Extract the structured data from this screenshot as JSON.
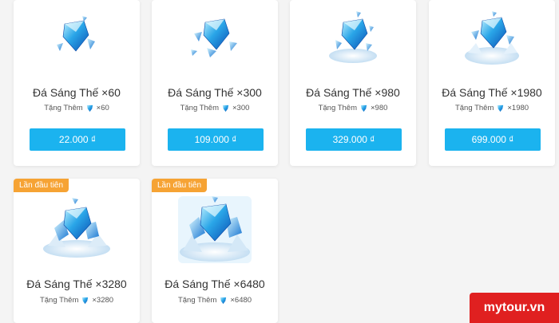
{
  "packages_row1": [
    {
      "name": "Đá Sáng Thế ×60",
      "bonus_label": "Tặng Thêm",
      "bonus_amount": "×60",
      "price": "22.000 ₫",
      "gem_icon": "crystal-gem-icon"
    },
    {
      "name": "Đá Sáng Thế ×300",
      "bonus_label": "Tặng Thêm",
      "bonus_amount": "×300",
      "price": "109.000 ₫",
      "gem_icon": "crystal-gem-icon"
    },
    {
      "name": "Đá Sáng Thế ×980",
      "bonus_label": "Tặng Thêm",
      "bonus_amount": "×980",
      "price": "329.000 ₫",
      "gem_icon": "crystal-gem-icon"
    },
    {
      "name": "Đá Sáng Thế ×1980",
      "bonus_label": "Tặng Thêm",
      "bonus_amount": "×1980",
      "price": "699.000 ₫",
      "gem_icon": "crystal-gem-icon"
    }
  ],
  "packages_row2": [
    {
      "badge": "Lần đầu tiên",
      "name": "Đá Sáng Thế ×3280",
      "bonus_label": "Tặng Thêm",
      "bonus_amount": "×3280",
      "gem_icon": "crystal-gem-icon"
    },
    {
      "badge": "Lần đầu tiên",
      "name": "Đá Sáng Thế ×6480",
      "bonus_label": "Tặng Thêm",
      "bonus_amount": "×6480",
      "gem_icon": "crystal-gem-icon"
    }
  ],
  "watermark": "mytour.vn",
  "colors": {
    "price_button": "#1bb3ef",
    "badge": "#f6a334",
    "watermark": "#e02020",
    "gem": "#2aa6e8"
  }
}
